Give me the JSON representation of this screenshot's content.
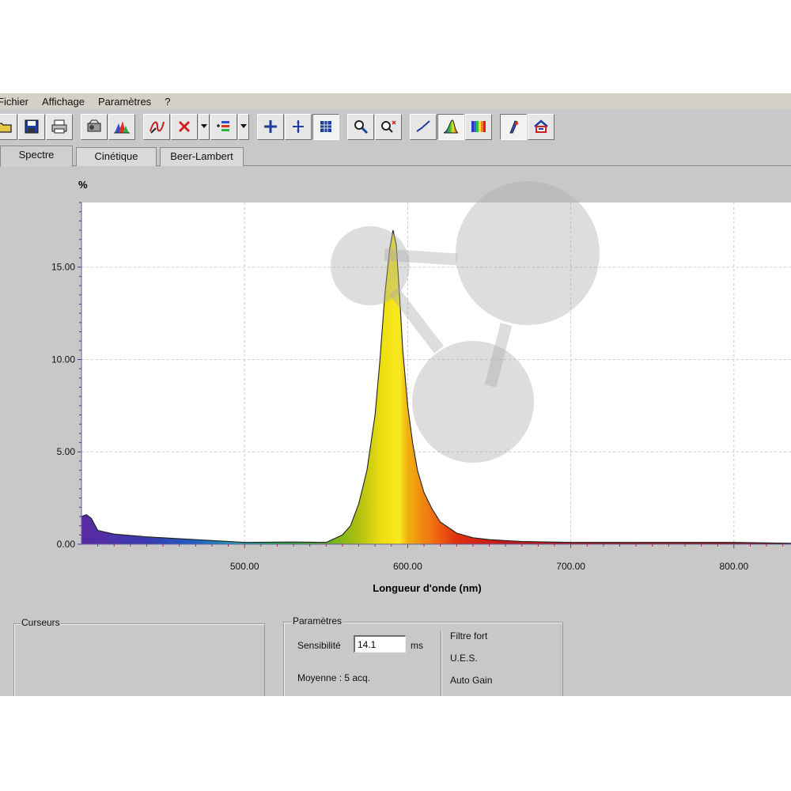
{
  "menu": [
    "Fichier",
    "Affichage",
    "Paramètres",
    "?"
  ],
  "tabs": [
    {
      "label": "Spectre",
      "active": true
    },
    {
      "label": "Cinétique",
      "active": false
    },
    {
      "label": "Beer-Lambert",
      "active": false
    }
  ],
  "toolbar": {
    "groups": [
      [
        "open-folder-icon",
        "save-icon",
        "print-icon"
      ],
      [
        "spectrometer-icon",
        "spectrum-color-icon"
      ],
      [
        "curve-edit-icon",
        "delete-icon",
        "dropdown-icon",
        "baseline-icon",
        "dropdown-icon"
      ],
      [
        "crosshair-icon",
        "add-cursor-icon",
        "grid-icon"
      ],
      [
        "zoom-icon",
        "zoom-auto-icon"
      ],
      [
        "line-mode-icon",
        "filled-spectrum-icon",
        "color-bands-icon"
      ],
      [
        "probe-icon",
        "calibration-icon"
      ]
    ],
    "pressed": [
      "grid-icon",
      "filled-spectrum-icon"
    ]
  },
  "chart_data": {
    "type": "area",
    "y_unit": "%",
    "xlabel": "Longueur d'onde (nm)",
    "xlim": [
      400,
      835
    ],
    "ylim": [
      0,
      18.5
    ],
    "x_ticks": [
      500,
      600,
      700,
      800
    ],
    "x_tick_labels": [
      "500.00",
      "600.00",
      "700.00",
      "800.00"
    ],
    "y_ticks": [
      0,
      5,
      10,
      15
    ],
    "y_tick_labels": [
      "0.00",
      "5.00",
      "10.00",
      "15.00"
    ],
    "grid": true,
    "fill": "visible-spectrum-gradient",
    "x": [
      400,
      403,
      406,
      410,
      420,
      440,
      470,
      500,
      530,
      550,
      560,
      565,
      570,
      575,
      580,
      583,
      586,
      589,
      591,
      593,
      595,
      597,
      600,
      603,
      606,
      610,
      615,
      620,
      630,
      640,
      650,
      670,
      700,
      750,
      800,
      835
    ],
    "y": [
      1.5,
      1.6,
      1.4,
      0.75,
      0.55,
      0.4,
      0.25,
      0.1,
      0.12,
      0.1,
      0.5,
      1.0,
      2.2,
      4.0,
      7.0,
      10.0,
      13.5,
      16.0,
      17.0,
      16.2,
      13.5,
      10.5,
      7.5,
      5.5,
      4.0,
      2.8,
      1.9,
      1.2,
      0.6,
      0.35,
      0.25,
      0.15,
      0.1,
      0.1,
      0.1,
      0.05
    ]
  },
  "cursors_panel": {
    "title": "Curseurs"
  },
  "params_panel": {
    "title": "Paramètres",
    "sensitivity_label": "Sensibilité",
    "sensitivity_value": "14.1",
    "sensitivity_unit": "ms",
    "average": "Moyenne : 5 acq.",
    "filter": "Filtre fort",
    "ues": "U.E.S.",
    "gain": "Auto Gain"
  }
}
